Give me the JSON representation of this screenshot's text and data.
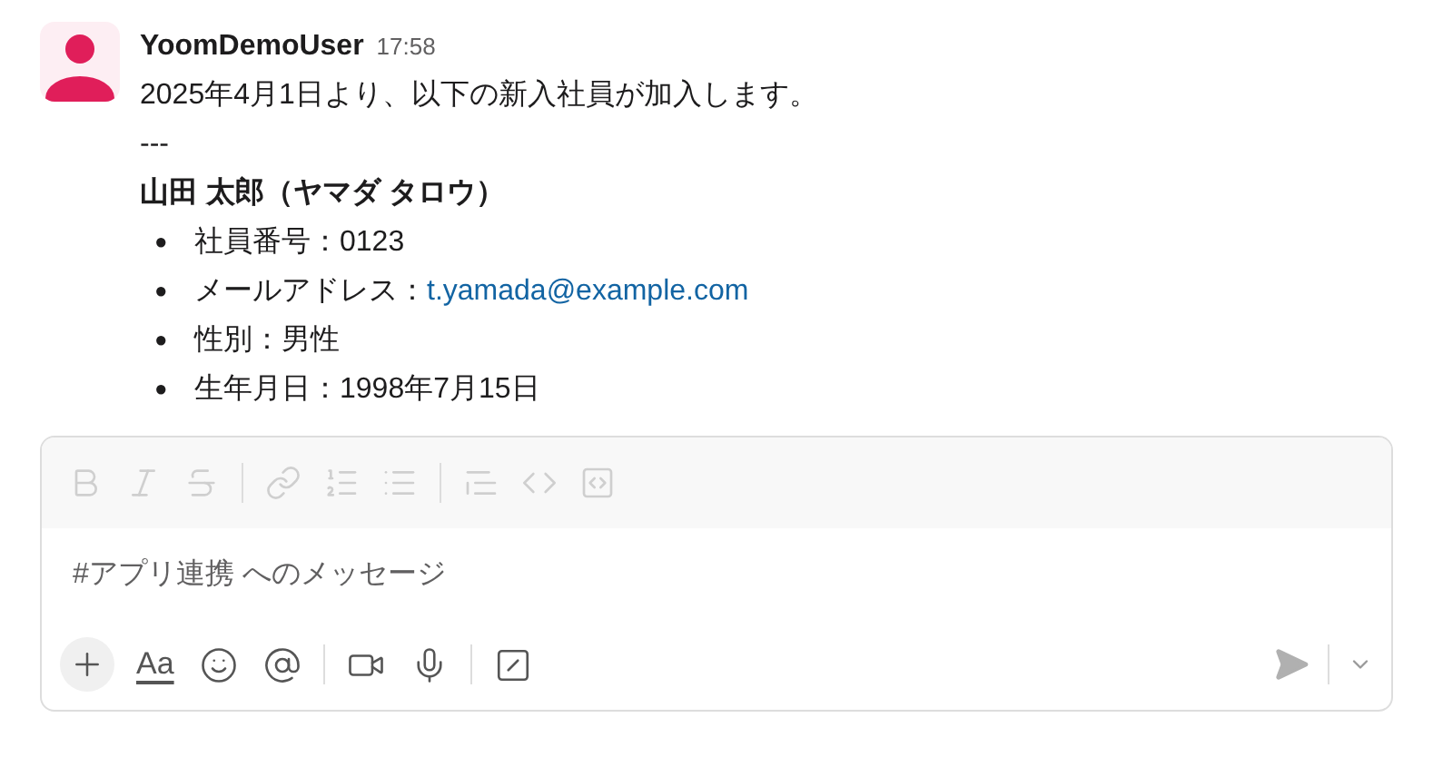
{
  "message": {
    "user": "YoomDemoUser",
    "time": "17:58",
    "intro": "2025年4月1日より、以下の新入社員が加入します。",
    "separator": "---",
    "heading": "山田 太郎（ヤマダ タロウ）",
    "items": [
      {
        "bullet": "●",
        "text": "社員番号：0123"
      },
      {
        "bullet": "●",
        "text": "メールアドレス：",
        "link": "t.yamada@example.com"
      },
      {
        "bullet": "●",
        "text": "性別：男性"
      },
      {
        "bullet": "●",
        "text": "生年月日：1998年7月15日"
      }
    ]
  },
  "composer": {
    "format_disabled": true,
    "placeholder": "#アプリ連携 へのメッセージ",
    "text_format_label": "Aa",
    "send_disabled": true
  }
}
